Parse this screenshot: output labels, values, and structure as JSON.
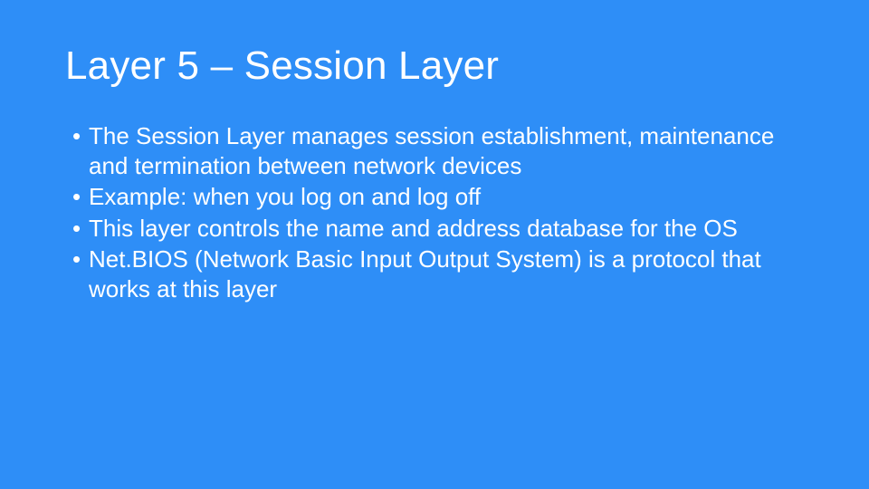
{
  "slide": {
    "title": "Layer 5 – Session Layer",
    "bullets": [
      "The Session Layer manages session establishment, maintenance and termination between network devices",
      "Example: when you log on and log off",
      "This layer controls the name and address database for the OS",
      "Net.BIOS (Network Basic Input Output System) is a protocol that works at this layer"
    ]
  }
}
